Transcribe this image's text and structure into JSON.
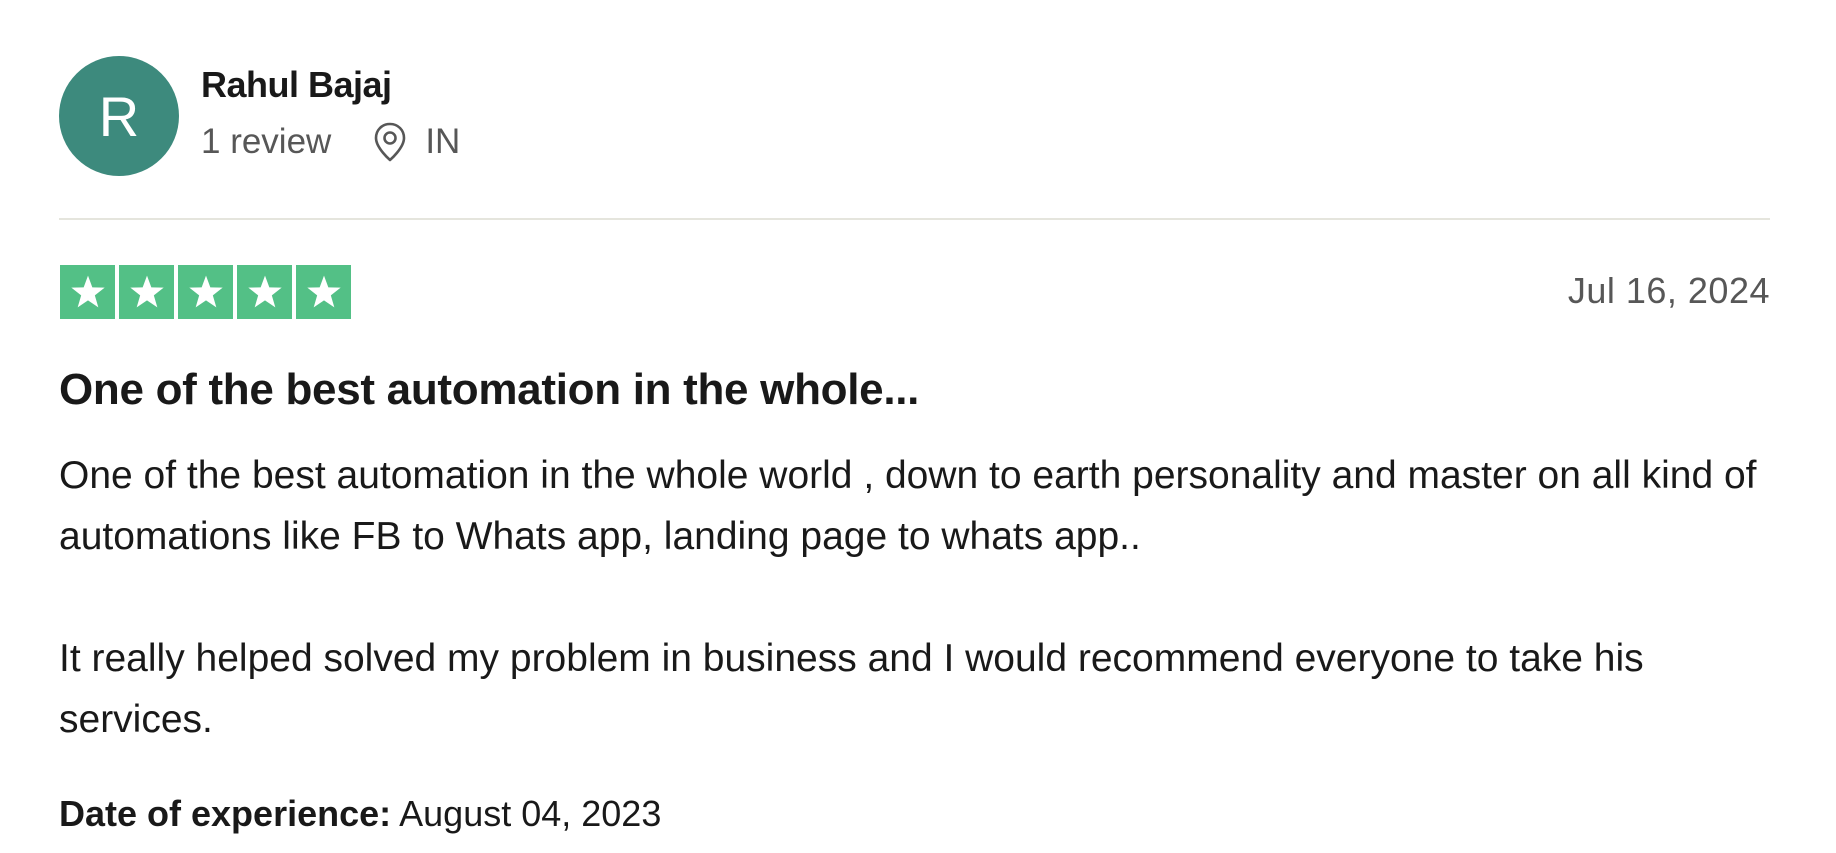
{
  "reviewer": {
    "initial": "R",
    "name": "Rahul Bajaj",
    "review_count": "1 review",
    "location_icon": "map-pin-icon",
    "country": "IN",
    "avatar_color": "#3d8a7d"
  },
  "review": {
    "rating": 5,
    "rating_max": 5,
    "star_color": "#53c086",
    "date": "Jul 16, 2024",
    "title": "One of the best automation in the whole...",
    "paragraphs": [
      "One of the best automation in the whole world , down to earth personality and master on all kind of automations like FB to Whats app, landing page to whats app..",
      "It really helped solved my problem in business and I would recommend everyone to take his services."
    ],
    "experience_label": "Date of experience:",
    "experience_date": "August 04, 2023"
  }
}
